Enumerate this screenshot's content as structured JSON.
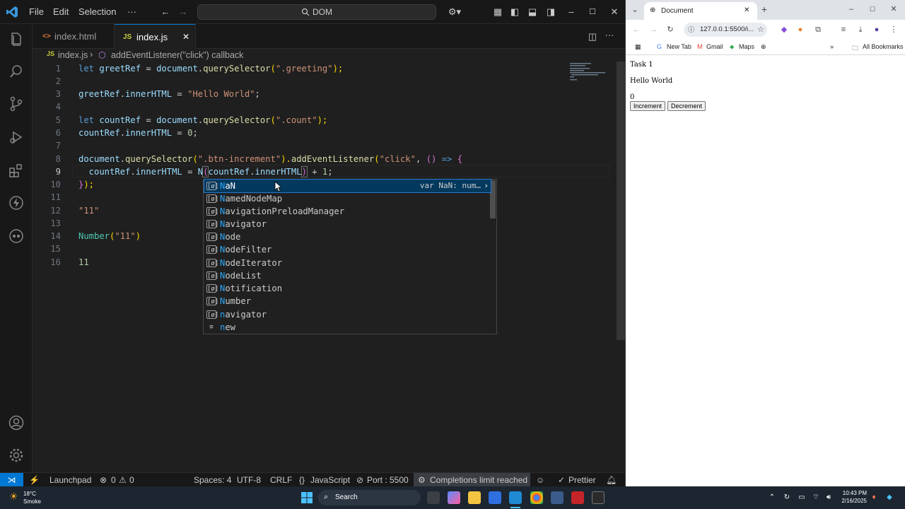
{
  "vscode": {
    "menu": [
      "File",
      "Edit",
      "Selection",
      "···"
    ],
    "command_center": "DOM",
    "tabs": [
      {
        "label": "index.html",
        "icon": "<>",
        "active": false
      },
      {
        "label": "index.js",
        "icon": "JS",
        "active": true
      }
    ],
    "breadcrumb": {
      "file": "index.js",
      "symbol": "addEventListener(\"click\") callback",
      "file_icon": "JS"
    },
    "line_numbers": [
      "1",
      "2",
      "3",
      "4",
      "5",
      "6",
      "7",
      "8",
      "9",
      "10",
      "11",
      "12",
      "13",
      "14",
      "15",
      "16"
    ],
    "current_line": "9",
    "code": {
      "l1": [
        "let ",
        "greetRef",
        " = ",
        "document",
        ".",
        "querySelector",
        "(",
        "\".greeting\"",
        ");"
      ],
      "l3": [
        "greetRef",
        ".",
        "innerHTML",
        " = ",
        "\"Hello World\"",
        ";"
      ],
      "l5": [
        "let ",
        "countRef",
        " = ",
        "document",
        ".",
        "querySelector",
        "(",
        "\".count\"",
        ");"
      ],
      "l6": [
        "countRef",
        ".",
        "innerHTML",
        " = ",
        "0",
        ";"
      ],
      "l8": [
        "document",
        ".",
        "querySelector",
        "(",
        "\".btn-increment\"",
        ").",
        "addEventListener",
        "(",
        "\"click\"",
        ", ",
        "()",
        " => ",
        "{"
      ],
      "l9": [
        "  countRef",
        ".",
        "innerHTML",
        " = ",
        "N",
        "(",
        "countRef",
        ".",
        "innerHTML",
        ")",
        " + ",
        "1",
        ";"
      ],
      "l10": [
        "}",
        ");"
      ],
      "l12": [
        "\"11\""
      ],
      "l14": [
        "Number",
        "(",
        "\"11\"",
        ")"
      ],
      "l16": [
        "11"
      ]
    },
    "suggestions": [
      {
        "match": "N",
        "rest": "aN",
        "detail": "var NaN: num…",
        "icon": "[ø]"
      },
      {
        "match": "N",
        "rest": "amedNodeMap",
        "icon": "[ø]"
      },
      {
        "match": "N",
        "rest": "avigationPreloadManager",
        "icon": "[ø]"
      },
      {
        "match": "N",
        "rest": "avigator",
        "icon": "[ø]"
      },
      {
        "match": "N",
        "rest": "ode",
        "icon": "[ø]"
      },
      {
        "match": "N",
        "rest": "odeFilter",
        "icon": "[ø]"
      },
      {
        "match": "N",
        "rest": "odeIterator",
        "icon": "[ø]"
      },
      {
        "match": "N",
        "rest": "odeList",
        "icon": "[ø]"
      },
      {
        "match": "N",
        "rest": "otification",
        "icon": "[ø]"
      },
      {
        "match": "N",
        "rest": "umber",
        "icon": "[ø]"
      },
      {
        "match": "n",
        "rest": "avigator",
        "icon": "[ø]"
      },
      {
        "match": "n",
        "rest": "ew",
        "icon": "≡"
      }
    ],
    "status": {
      "launchpad": "Launchpad",
      "errors": "0",
      "warnings": "0",
      "spaces": "Spaces: 4",
      "encoding": "UTF-8",
      "eol": "CRLF",
      "language": "JavaScript",
      "port": "Port : 5500",
      "completions": "Completions limit reached",
      "prettier": "Prettier"
    }
  },
  "chrome": {
    "tab_title": "Document",
    "url": "127.0.0.1:5500/i...",
    "bookmarks": [
      "New Tab",
      "Gmail",
      "Maps",
      "All Bookmarks"
    ],
    "page": {
      "task": "Task 1",
      "greeting": "Hello World",
      "count": "0",
      "increment": "Increment",
      "decrement": "Decrement"
    }
  },
  "taskbar": {
    "weather_temp": "18°C",
    "weather_desc": "Smoke",
    "search": "Search",
    "time": "10:43 PM",
    "date": "2/16/2025"
  },
  "colors": {
    "accent": "#0078d4",
    "editor_bg": "#1f1f1f",
    "keyword": "#569cd6",
    "string": "#ce9178",
    "function": "#dcdcaa",
    "variable": "#9cdcfe",
    "number": "#b5cea8",
    "suggest_selected": "#04395e"
  }
}
